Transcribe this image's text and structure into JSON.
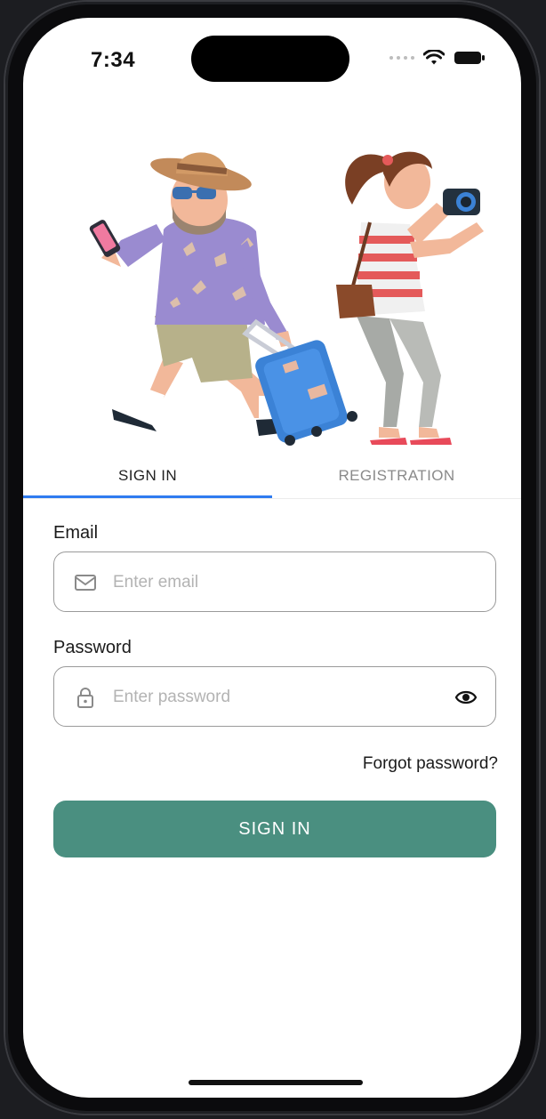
{
  "status_bar": {
    "time": "7:34"
  },
  "illustration": {
    "name": "travelers-illustration"
  },
  "tabs": [
    {
      "label": "SIGN IN",
      "active": true
    },
    {
      "label": "REGISTRATION",
      "active": false
    }
  ],
  "form": {
    "email": {
      "label": "Email",
      "placeholder": "Enter email",
      "value": "",
      "icon": "mail-icon"
    },
    "password": {
      "label": "Password",
      "placeholder": "Enter password",
      "value": "",
      "icon": "lock-icon",
      "toggle_icon": "eye-icon"
    },
    "forgot_label": "Forgot password?",
    "submit_label": "SIGN IN"
  },
  "colors": {
    "primary_button": "#4a8f80",
    "tab_indicator": "#2f7bf0",
    "active_tab_text": "#222222",
    "inactive_tab_text": "#8a8a8a"
  }
}
